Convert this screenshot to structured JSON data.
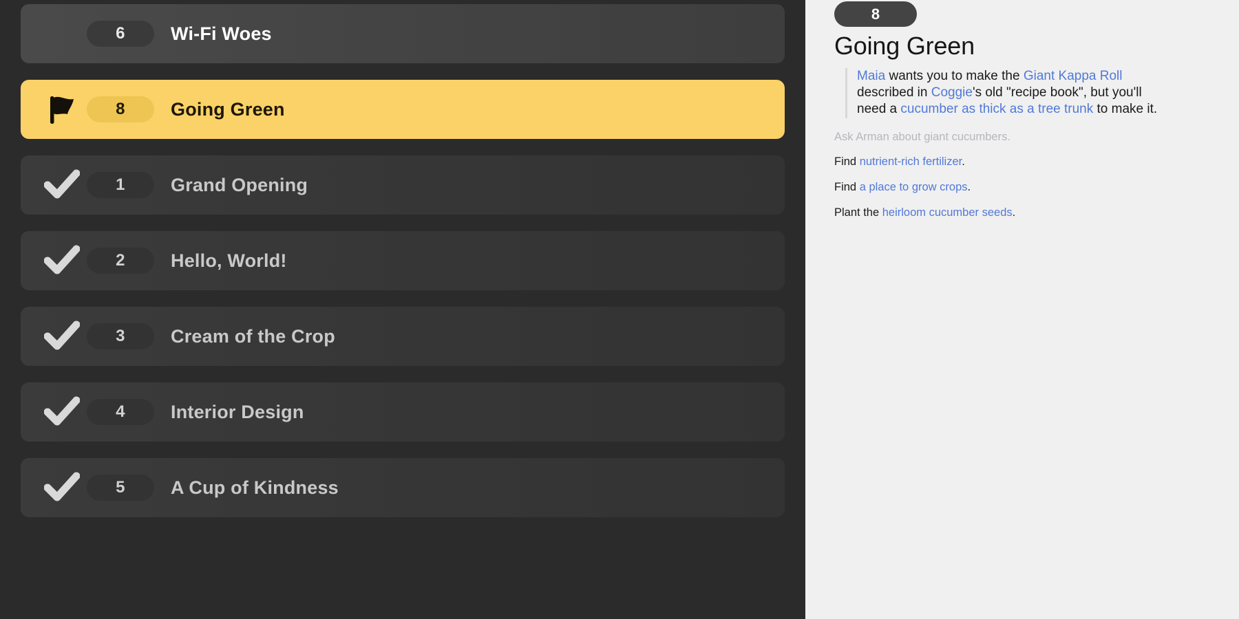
{
  "theme": {
    "accent": "#fbd267",
    "panel_dark": "#2b2b2b",
    "panel_light": "#f0f0f0",
    "link_blue": "#5179d8",
    "done_grey": "#b6b6bd"
  },
  "quest_list": {
    "rows": [
      {
        "number": "6",
        "title": "Wi-Fi Woes",
        "icon": "none",
        "state": "available"
      },
      {
        "number": "8",
        "title": "Going Green",
        "icon": "flag-icon",
        "state": "active"
      },
      {
        "number": "1",
        "title": "Grand Opening",
        "icon": "check-icon",
        "state": "complete"
      },
      {
        "number": "2",
        "title": "Hello, World!",
        "icon": "check-icon",
        "state": "complete"
      },
      {
        "number": "3",
        "title": "Cream of the Crop",
        "icon": "check-icon",
        "state": "complete"
      },
      {
        "number": "4",
        "title": "Interior Design",
        "icon": "check-icon",
        "state": "complete"
      },
      {
        "number": "5",
        "title": "A Cup of Kindness",
        "icon": "check-icon",
        "state": "complete"
      }
    ]
  },
  "detail": {
    "number": "8",
    "title": "Going Green",
    "description_parts": [
      {
        "text": "Maia",
        "link": true
      },
      {
        "text": " wants you to make the ",
        "link": false
      },
      {
        "text": "Giant Kappa Roll",
        "link": true
      },
      {
        "text": " described in ",
        "link": false
      },
      {
        "text": "Coggie",
        "link": true
      },
      {
        "text": "'s old \"recipe book\", but you'll need a ",
        "link": false
      },
      {
        "text": "cucumber as thick as a tree trunk",
        "link": true
      },
      {
        "text": " to make it.",
        "link": false
      }
    ],
    "objectives": [
      {
        "done": true,
        "parts": [
          {
            "text": "Ask ",
            "link": false
          },
          {
            "text": "Arman",
            "link": true
          },
          {
            "text": " about ",
            "link": false
          },
          {
            "text": "giant cucumbers",
            "link": true
          },
          {
            "text": ".",
            "link": false
          }
        ]
      },
      {
        "done": false,
        "parts": [
          {
            "text": "Find ",
            "link": false
          },
          {
            "text": "nutrient-rich fertilizer",
            "link": true
          },
          {
            "text": ".",
            "link": false
          }
        ]
      },
      {
        "done": false,
        "parts": [
          {
            "text": "Find ",
            "link": false
          },
          {
            "text": "a place to grow crops",
            "link": true
          },
          {
            "text": ".",
            "link": false
          }
        ]
      },
      {
        "done": false,
        "parts": [
          {
            "text": "Plant the ",
            "link": false
          },
          {
            "text": "heirloom cucumber seeds",
            "link": true
          },
          {
            "text": ".",
            "link": false
          }
        ]
      }
    ]
  }
}
